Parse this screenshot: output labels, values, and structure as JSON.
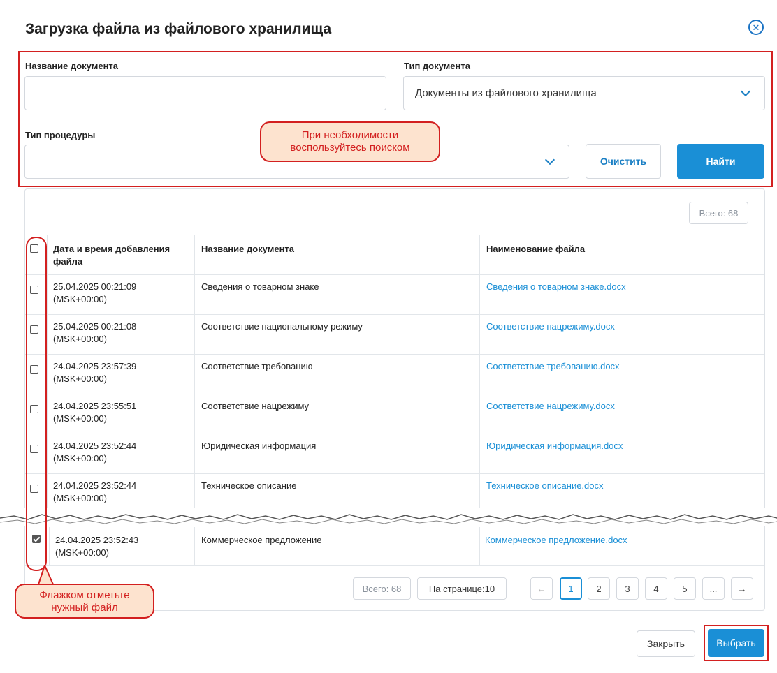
{
  "dialog": {
    "title": "Загрузка файла из файлового хранилища",
    "close_icon": "close-circle-icon"
  },
  "filters": {
    "doc_name_label": "Название документа",
    "doc_name_value": "",
    "doc_type_label": "Тип документа",
    "doc_type_value": "Документы из файлового хранилища",
    "procedure_type_label": "Тип процедуры",
    "procedure_type_value": "",
    "clear_label": "Очистить",
    "find_label": "Найти"
  },
  "annotations": {
    "search_hint": [
      "При необходимости",
      "воспользуйтесь поиском"
    ],
    "checkbox_hint": [
      "Флажком отметьте",
      "нужный файл"
    ]
  },
  "table": {
    "total_badge": "Всего: 68",
    "columns": [
      "Дата и время добавления файла",
      "Название документа",
      "Наименование файла"
    ],
    "rows": [
      {
        "date": "25.04.2025 00:21:09",
        "tz": "(MSK+00:00)",
        "name": "Сведения о товарном знаке",
        "file": "Сведения о товарном знаке.docx",
        "checked": false
      },
      {
        "date": "25.04.2025 00:21:08",
        "tz": "(MSK+00:00)",
        "name": "Соответствие национальному режиму",
        "file": "Соответствие нацрежиму.docx",
        "checked": false
      },
      {
        "date": "24.04.2025 23:57:39",
        "tz": "(MSK+00:00)",
        "name": "Соответствие требованию",
        "file": "Соответствие требованию.docx",
        "checked": false
      },
      {
        "date": "24.04.2025 23:55:51",
        "tz": "(MSK+00:00)",
        "name": "Соответствие нацрежиму",
        "file": "Соответствие нацрежиму.docx",
        "checked": false
      },
      {
        "date": "24.04.2025 23:52:44",
        "tz": "(MSK+00:00)",
        "name": "Юридическая информация",
        "file": "Юридическая информация.docx",
        "checked": false
      },
      {
        "date": "24.04.2025 23:52:44",
        "tz": "(MSK+00:00)",
        "name": "Техническое описание",
        "file": "Техническое описание.docx",
        "checked": false
      },
      {
        "date": "24.04.2025 23:52:43",
        "tz": "(MSK+00:00)",
        "name": "Коммерческое предложение",
        "file": "Коммерческое предложение.docx",
        "checked": true
      }
    ]
  },
  "pagination": {
    "total": "Всего: 68",
    "per_page": "На странице:10",
    "prev": "←",
    "pages": [
      "1",
      "2",
      "3",
      "4",
      "5",
      "..."
    ],
    "current_page": "1",
    "next": "→"
  },
  "footer": {
    "close_label": "Закрыть",
    "select_label": "Выбрать"
  },
  "colors": {
    "accent": "#1a8fd6",
    "annotation": "#d32020",
    "annotation_fill": "#fde3cf"
  }
}
